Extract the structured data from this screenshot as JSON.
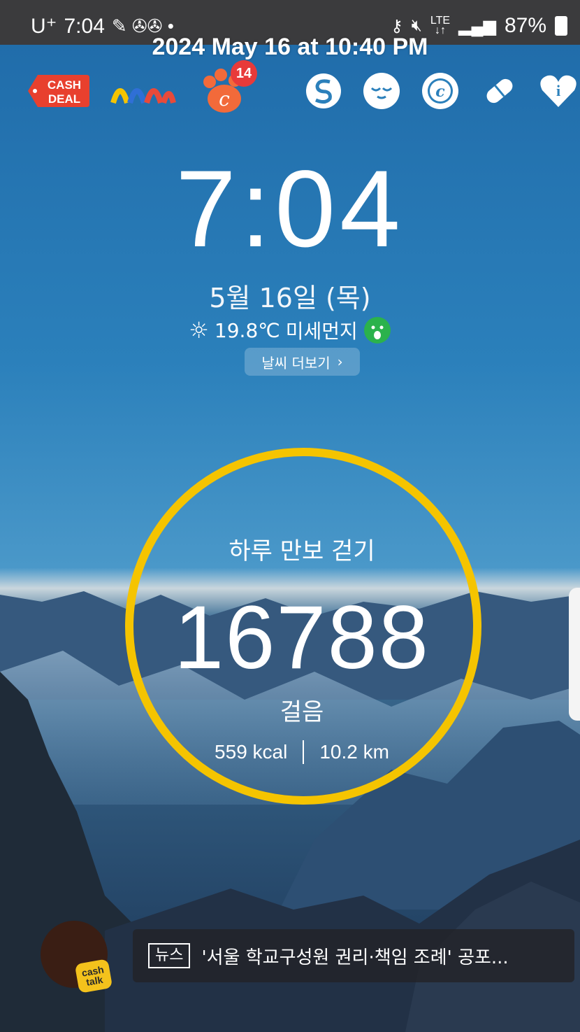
{
  "status_bar": {
    "carrier": "U⁺",
    "time": "7:04",
    "battery": "87%"
  },
  "stamp": "2024 May 16 at 10:40 PM",
  "apps": [
    {
      "name": "cash-deal",
      "label": "CASH DEAL"
    },
    {
      "name": "app-2"
    },
    {
      "name": "cash-paw",
      "badge": "14"
    },
    {
      "name": "app-s"
    },
    {
      "name": "app-face"
    },
    {
      "name": "app-c"
    },
    {
      "name": "app-pill"
    },
    {
      "name": "app-heart-info"
    }
  ],
  "clock": {
    "time": "7:04"
  },
  "date": "5월 16일 (목)",
  "weather": {
    "temp": "19.8℃",
    "dust_label": "미세먼지",
    "more_label": "날씨 더보기"
  },
  "pedometer": {
    "title": "하루 만보 걷기",
    "steps": "16788",
    "unit": "걸음",
    "kcal": "559 kcal",
    "km": "10.2 km"
  },
  "news": {
    "tag": "뉴스",
    "headline": "'서울 학교구성원 권리·책임 조례' 공포..."
  },
  "cashtalk": {
    "line1": "cash",
    "line2": "talk"
  },
  "colors": {
    "ring": "#f5c400",
    "status_bg": "#3b3b3d",
    "badge": "#e83a3a"
  }
}
